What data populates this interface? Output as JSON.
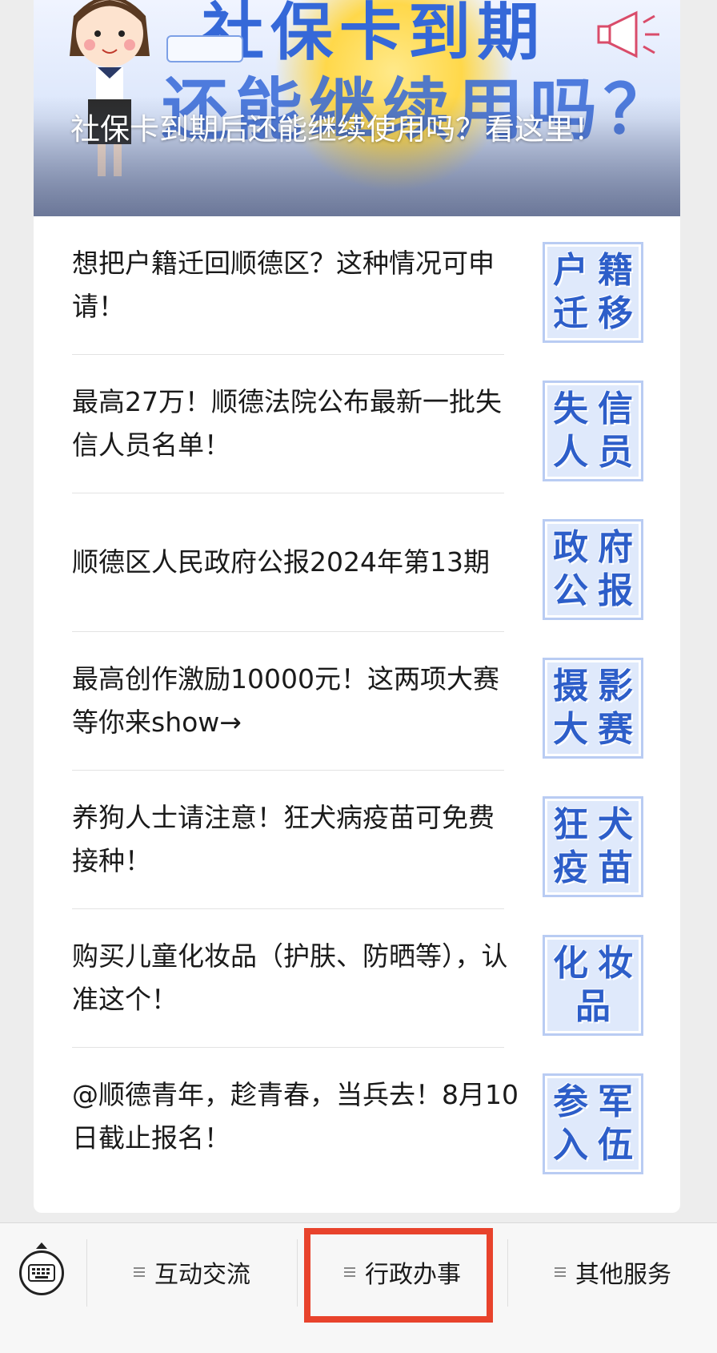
{
  "hero": {
    "banner_line1": "社保卡到期",
    "banner_line2": "还能继续用吗？",
    "title": "社保卡到期后还能继续使用吗？看这里！"
  },
  "articles": [
    {
      "title": "想把户籍迁回顺德区？这种情况可申请！",
      "thumb": [
        "户",
        "籍",
        "迁",
        "移"
      ]
    },
    {
      "title": "最高27万！顺德法院公布最新一批失信人员名单！",
      "thumb": [
        "失",
        "信",
        "人",
        "员"
      ]
    },
    {
      "title": "顺德区人民政府公报2024年第13期",
      "thumb": [
        "政",
        "府",
        "公",
        "报"
      ]
    },
    {
      "title": "最高创作激励10000元！这两项大赛等你来show→",
      "thumb": [
        "摄",
        "影",
        "大",
        "赛"
      ]
    },
    {
      "title": "养狗人士请注意！狂犬病疫苗可免费接种！",
      "thumb": [
        "狂",
        "犬",
        "疫",
        "苗"
      ]
    },
    {
      "title": "购买儿童化妆品（护肤、防晒等），认准这个！",
      "thumb": [
        "化",
        "妆",
        "品"
      ]
    },
    {
      "title": "@顺德青年，趁青春，当兵去！8月10日截止报名！",
      "thumb": [
        "参",
        "军",
        "入",
        "伍"
      ]
    }
  ],
  "bottom_menu": {
    "keyboard_icon": "keyboard-icon",
    "items": [
      {
        "label": "互动交流"
      },
      {
        "label": "行政办事"
      },
      {
        "label": "其他服务"
      }
    ],
    "highlight_color": "#e8432c"
  }
}
